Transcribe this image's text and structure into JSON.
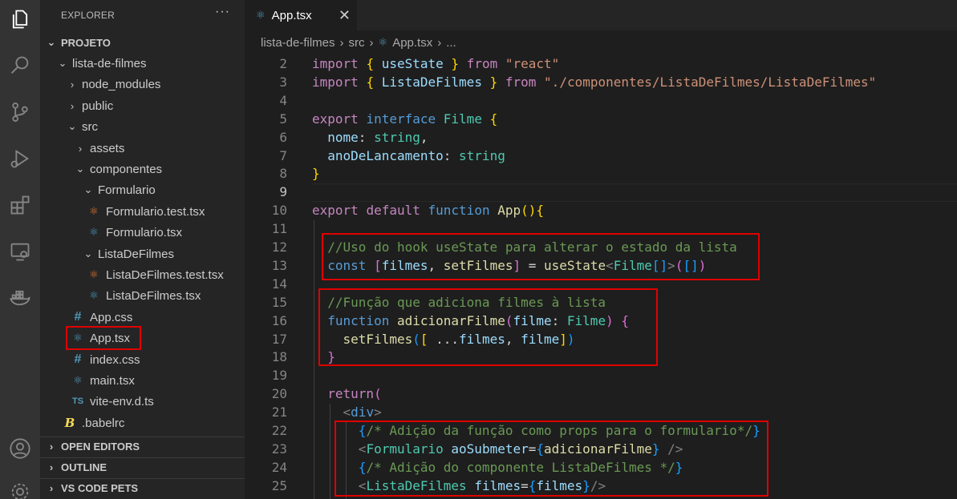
{
  "sidebar": {
    "title": "EXPLORER",
    "more": "···",
    "project": "PROJETO",
    "tree": [
      {
        "label": "lista-de-filmes"
      },
      {
        "label": "node_modules"
      },
      {
        "label": "public"
      },
      {
        "label": "src"
      },
      {
        "label": "assets"
      },
      {
        "label": "componentes"
      },
      {
        "label": "Formulario"
      },
      {
        "label": "Formulario.test.tsx"
      },
      {
        "label": "Formulario.tsx"
      },
      {
        "label": "ListaDeFilmes"
      },
      {
        "label": "ListaDeFilmes.test.tsx"
      },
      {
        "label": "ListaDeFilmes.tsx"
      },
      {
        "label": "App.css"
      },
      {
        "label": "App.tsx"
      },
      {
        "label": "index.css"
      },
      {
        "label": "main.tsx"
      },
      {
        "label": "vite-env.d.ts"
      },
      {
        "label": ".babelrc"
      }
    ],
    "sections": [
      "OPEN EDITORS",
      "OUTLINE",
      "VS CODE PETS"
    ],
    "icons": {
      "css": "#",
      "ts": "TS",
      "babel": "B",
      "chev_right": "›",
      "chev_down": "⌄"
    }
  },
  "tab": {
    "label": "App.tsx",
    "close": "✕"
  },
  "breadcrumb": [
    "lista-de-filmes",
    "src",
    "App.tsx",
    "..."
  ],
  "editor": {
    "line_numbers": [
      "2",
      "3",
      "4",
      "5",
      "6",
      "7",
      "8",
      "9",
      "10",
      "11",
      "12",
      "13",
      "14",
      "15",
      "16",
      "17",
      "18",
      "19",
      "20",
      "21",
      "22",
      "23",
      "24",
      "25"
    ],
    "current_line": "9",
    "lines": [
      [
        [
          "kc",
          "import"
        ],
        [
          "pl",
          " "
        ],
        [
          "b1",
          "{"
        ],
        [
          "pl",
          " "
        ],
        [
          "vr",
          "useState"
        ],
        [
          "pl",
          " "
        ],
        [
          "b1",
          "}"
        ],
        [
          "pl",
          " "
        ],
        [
          "kc",
          "from"
        ],
        [
          "pl",
          " "
        ],
        [
          "str",
          "\"react\""
        ]
      ],
      [
        [
          "kc",
          "import"
        ],
        [
          "pl",
          " "
        ],
        [
          "b1",
          "{"
        ],
        [
          "pl",
          " "
        ],
        [
          "vr",
          "ListaDeFilmes"
        ],
        [
          "pl",
          " "
        ],
        [
          "b1",
          "}"
        ],
        [
          "pl",
          " "
        ],
        [
          "kc",
          "from"
        ],
        [
          "pl",
          " "
        ],
        [
          "str",
          "\"./componentes/ListaDeFilmes/ListaDeFilmes\""
        ]
      ],
      [],
      [
        [
          "kc",
          "export"
        ],
        [
          "pl",
          " "
        ],
        [
          "kw",
          "interface"
        ],
        [
          "pl",
          " "
        ],
        [
          "ty",
          "Filme"
        ],
        [
          "pl",
          " "
        ],
        [
          "b1",
          "{"
        ]
      ],
      [
        [
          "pl",
          "  "
        ],
        [
          "vr",
          "nome"
        ],
        [
          "pl",
          ": "
        ],
        [
          "ty",
          "string"
        ],
        [
          "pl",
          ","
        ]
      ],
      [
        [
          "pl",
          "  "
        ],
        [
          "vr",
          "anoDeLancamento"
        ],
        [
          "pl",
          ": "
        ],
        [
          "ty",
          "string"
        ]
      ],
      [
        [
          "b1",
          "}"
        ]
      ],
      [],
      [
        [
          "kc",
          "export"
        ],
        [
          "pl",
          " "
        ],
        [
          "kc",
          "default"
        ],
        [
          "pl",
          " "
        ],
        [
          "kw",
          "function"
        ],
        [
          "pl",
          " "
        ],
        [
          "fn",
          "App"
        ],
        [
          "b1",
          "()"
        ],
        [
          "b1",
          "{"
        ]
      ],
      [],
      [
        [
          "pl",
          "  "
        ],
        [
          "cm",
          "//Uso do hook useState para alterar o estado da lista"
        ]
      ],
      [
        [
          "pl",
          "  "
        ],
        [
          "kw",
          "const"
        ],
        [
          "pl",
          " "
        ],
        [
          "b2",
          "["
        ],
        [
          "vr",
          "filmes"
        ],
        [
          "pl",
          ", "
        ],
        [
          "fn",
          "setFilmes"
        ],
        [
          "b2",
          "]"
        ],
        [
          "pl",
          " = "
        ],
        [
          "fn",
          "useState"
        ],
        [
          "ang",
          "<"
        ],
        [
          "ty",
          "Filme"
        ],
        [
          "b3",
          "[]"
        ],
        [
          "ang",
          ">"
        ],
        [
          "b2",
          "("
        ],
        [
          "b3",
          "[]"
        ],
        [
          "b2",
          ")"
        ]
      ],
      [],
      [
        [
          "pl",
          "  "
        ],
        [
          "cm",
          "//Função que adiciona filmes à lista"
        ]
      ],
      [
        [
          "pl",
          "  "
        ],
        [
          "kw",
          "function"
        ],
        [
          "pl",
          " "
        ],
        [
          "fn",
          "adicionarFilme"
        ],
        [
          "b2",
          "("
        ],
        [
          "vr",
          "filme"
        ],
        [
          "pl",
          ": "
        ],
        [
          "ty",
          "Filme"
        ],
        [
          "b2",
          ")"
        ],
        [
          "pl",
          " "
        ],
        [
          "b2",
          "{"
        ]
      ],
      [
        [
          "pl",
          "    "
        ],
        [
          "fn",
          "setFilmes"
        ],
        [
          "b3",
          "("
        ],
        [
          "b1",
          "["
        ],
        [
          "pl",
          " ..."
        ],
        [
          "vr",
          "filmes"
        ],
        [
          "pl",
          ", "
        ],
        [
          "vr",
          "filme"
        ],
        [
          "b1",
          "]"
        ],
        [
          "b3",
          ")"
        ]
      ],
      [
        [
          "pl",
          "  "
        ],
        [
          "b2",
          "}"
        ]
      ],
      [],
      [
        [
          "pl",
          "  "
        ],
        [
          "kc",
          "return"
        ],
        [
          "b2",
          "("
        ]
      ],
      [
        [
          "pl",
          "    "
        ],
        [
          "ang",
          "<"
        ],
        [
          "tg",
          "div"
        ],
        [
          "ang",
          ">"
        ]
      ],
      [
        [
          "pl",
          "      "
        ],
        [
          "b3",
          "{"
        ],
        [
          "cm",
          "/* Adição da função como props para o formulario*/"
        ],
        [
          "b3",
          "}"
        ]
      ],
      [
        [
          "pl",
          "      "
        ],
        [
          "ang",
          "<"
        ],
        [
          "tc",
          "Formulario"
        ],
        [
          "pl",
          " "
        ],
        [
          "at",
          "aoSubmeter"
        ],
        [
          "pl",
          "="
        ],
        [
          "b3",
          "{"
        ],
        [
          "fn",
          "adicionarFilme"
        ],
        [
          "b3",
          "}"
        ],
        [
          "pl",
          " "
        ],
        [
          "ang",
          "/>"
        ]
      ],
      [
        [
          "pl",
          "      "
        ],
        [
          "b3",
          "{"
        ],
        [
          "cm",
          "/* Adição do componente ListaDeFilmes */"
        ],
        [
          "b3",
          "}"
        ]
      ],
      [
        [
          "pl",
          "      "
        ],
        [
          "ang",
          "<"
        ],
        [
          "tc",
          "ListaDeFilmes"
        ],
        [
          "pl",
          " "
        ],
        [
          "at",
          "filmes"
        ],
        [
          "pl",
          "="
        ],
        [
          "b3",
          "{"
        ],
        [
          "vr",
          "filmes"
        ],
        [
          "b3",
          "}"
        ],
        [
          "ang",
          "/>"
        ]
      ]
    ]
  }
}
